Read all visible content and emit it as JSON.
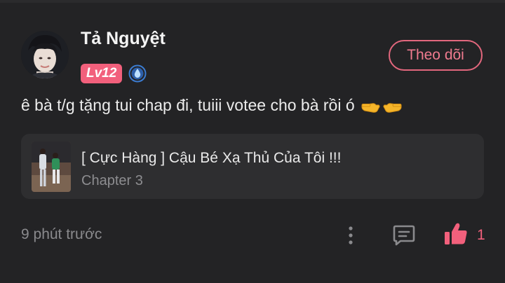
{
  "comment": {
    "username": "Tả Nguyệt",
    "level_badge": "Lv12",
    "follow_label": "Theo dõi",
    "text": "ê bà t/g tặng tui chap đi, tuiii votee cho bà rồi ó",
    "chapter_card": {
      "story_title": "[ Cực Hàng ] Cậu Bé Xạ Thủ Của Tôi !!!",
      "chapter_label": "Chapter 3"
    },
    "timestamp": "9 phút trước",
    "like_count": "1"
  },
  "icons": {
    "rank": "water-drop-rank-icon",
    "pointing_emoji": "pointing-hands-emoji",
    "more": "more-vertical-icon",
    "reply": "comment-reply-icon",
    "like": "thumbs-up-icon"
  },
  "colors": {
    "background": "#232325",
    "accent": "#f2607c",
    "card": "#2e2e30",
    "muted_text": "#8a8a8d"
  }
}
